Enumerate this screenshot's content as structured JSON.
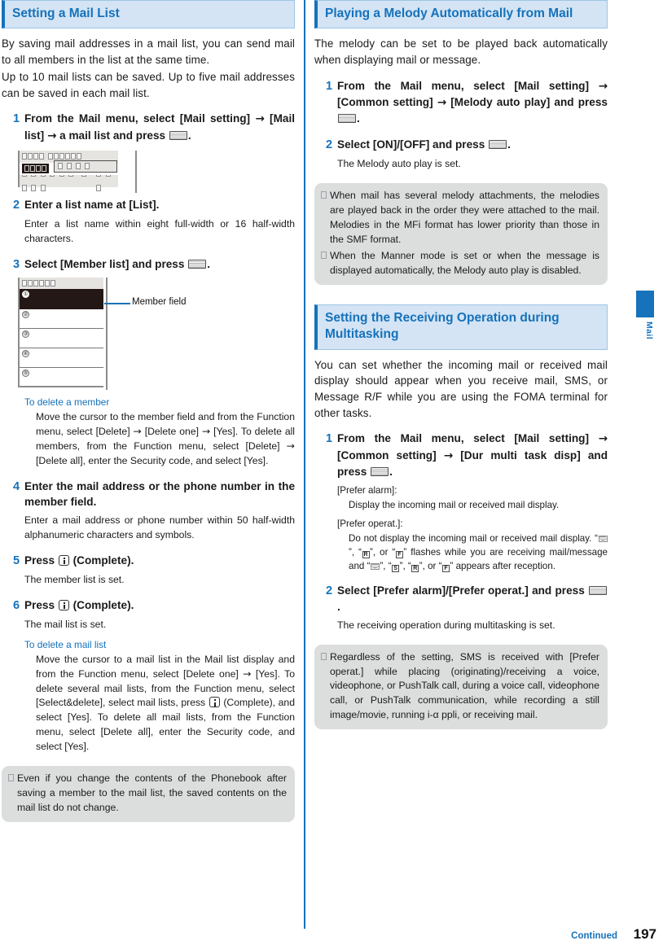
{
  "colors": {
    "accent": "#1572bb",
    "heading_band_bg": "#d4e4f4",
    "note_bg": "#dcdddd",
    "mock_screen_bg": "#e6e4e0",
    "mock_selected": "#231815"
  },
  "footer": {
    "continued_label": "Continued",
    "page_number": "197"
  },
  "edge_tab": {
    "label": "Mail"
  },
  "left_column": {
    "heading": "Setting a Mail List",
    "intro_paragraphs": [
      "By saving mail addresses in a mail list, you can send mail to all members in the list at the same time.",
      "Up to 10 mail lists can be saved. Up to five mail addresses can be saved in each mail list."
    ],
    "steps": [
      {
        "num": "1",
        "text_before": "From the Mail menu, select [Mail setting] ",
        "arrow1": "→",
        "text_mid": " [Mail list] ",
        "arrow2": "→",
        "text_after": " a mail list and press ",
        "key_icon": "select-key-icon",
        "period": "."
      },
      {
        "num": "2",
        "title": "Enter a list name at [List].",
        "body": "Enter a list name within eight full-width or 16 half-width characters."
      },
      {
        "num": "3",
        "text_before": "Select [Member list] and press ",
        "key_icon": "select-key-icon",
        "period": "."
      },
      {
        "num": "4",
        "title": "Enter the mail address or the phone number in the member field.",
        "body": "Enter a mail address or phone number within 50 half-width alphanumeric characters and symbols."
      },
      {
        "num": "5",
        "text_before": "Press ",
        "key_icon": "function-key-icon",
        "text_after": " (Complete).",
        "body": "The member list is set."
      },
      {
        "num": "6",
        "text_before": "Press ",
        "key_icon": "function-key-icon",
        "text_after": " (Complete).",
        "body": "The mail list is set."
      }
    ],
    "delete_member": {
      "title": "To delete a member",
      "body_1": "Move the cursor to the member field and from the Function menu, select [Delete] ",
      "arrow1": "→",
      "body_2": " [Delete one] ",
      "arrow2": "→",
      "body_3": " [Yes]. To delete all members, from the Function menu, select [Delete] ",
      "arrow3": "→",
      "body_4": " [Delete all], enter the Security code, and select [Yes]."
    },
    "delete_mail_list": {
      "title": "To delete a mail list",
      "body_1": "Move the cursor to a mail list in the Mail list display and from the Function menu, select [Delete one] ",
      "arrow1": "→",
      "body_2": " [Yes]. To delete several mail lists, from the Function menu, select [Select&delete], select mail lists, press ",
      "key_icon": "function-key-icon",
      "body_3": " (Complete), and select [Yes]. To delete all mail lists, from the Function menu, select [Delete all], enter the Security code, and select [Yes]."
    },
    "note": {
      "bullet": "tofu-bullet-icon",
      "text": "Even if you change the contents of the Phonebook after saving a member to the mail list, the saved contents on the mail list do not change."
    },
    "mock_member_list": {
      "callout_label": "Member field",
      "rows": [
        "①",
        "②",
        "③",
        "④",
        "⑤"
      ],
      "selected_row_index": 0
    }
  },
  "right_column": {
    "section_melody": {
      "heading": "Playing a Melody Automatically from Mail",
      "intro": "The melody can be set to be played back automatically when displaying mail or message.",
      "steps": [
        {
          "num": "1",
          "text_before": "From the Mail menu, select [Mail setting] ",
          "arrow1": "→",
          "text_mid": " [Common setting] ",
          "arrow2": "→",
          "text_after": " [Melody auto play] and press ",
          "key_icon": "select-key-icon",
          "period": "."
        },
        {
          "num": "2",
          "text_before": "Select [ON]/[OFF] and press ",
          "key_icon": "select-key-icon",
          "period": ".",
          "body": "The Melody auto play is set."
        }
      ],
      "notes": [
        "When mail has several melody attachments, the melodies are played back in the order they were attached to the mail. Melodies in the MFi format has lower priority than those in the SMF format.",
        "When the Manner mode is set or when the message is displayed automatically, the Melody auto play is disabled."
      ]
    },
    "section_multitasking": {
      "heading": "Setting the Receiving Operation during Multitasking",
      "intro": "You can set whether the incoming mail or received mail display should appear when you receive mail, SMS, or Message R/F while you are using the FOMA terminal for other tasks.",
      "step1": {
        "num": "1",
        "text_before": "From the Mail menu, select [Mail setting] ",
        "arrow1": "→",
        "text_mid": " [Common setting] ",
        "arrow2": "→",
        "text_after": " [Dur multi task disp] and press ",
        "key_icon": "select-key-icon",
        "period": ".",
        "options": [
          {
            "label": "[Prefer alarm]:",
            "desc": "Display the incoming mail or received mail display."
          },
          {
            "label": "[Prefer operat.]:",
            "desc_1": "Do not display the incoming mail or received mail display. “",
            "mark_1": "envelope-mark-icon",
            "desc_2": "”, “",
            "mark_2": "R",
            "desc_3": "”, or “",
            "mark_3": "F",
            "desc_4": "” flashes while you are receiving mail/message and “",
            "mark_4": "envelope-mark-icon",
            "desc_5": "”, “",
            "mark_5": "S",
            "desc_6": "”, “",
            "mark_6": "R",
            "desc_7": "”, or “",
            "mark_7": "F",
            "desc_8": "” appears after reception."
          }
        ]
      },
      "step2": {
        "num": "2",
        "text_before": "Select [Prefer alarm]/[Prefer operat.] and press ",
        "key_icon": "select-key-icon",
        "period": ".",
        "body": "The receiving operation during multitasking is set."
      },
      "note": "Regardless of the setting, SMS is received with [Prefer operat.] while placing (originating)/receiving a voice, videophone, or PushTalk call, during a voice call, videophone call, or PushTalk communication, while recording a still image/movie, running i-α ppli, or receiving mail."
    }
  }
}
